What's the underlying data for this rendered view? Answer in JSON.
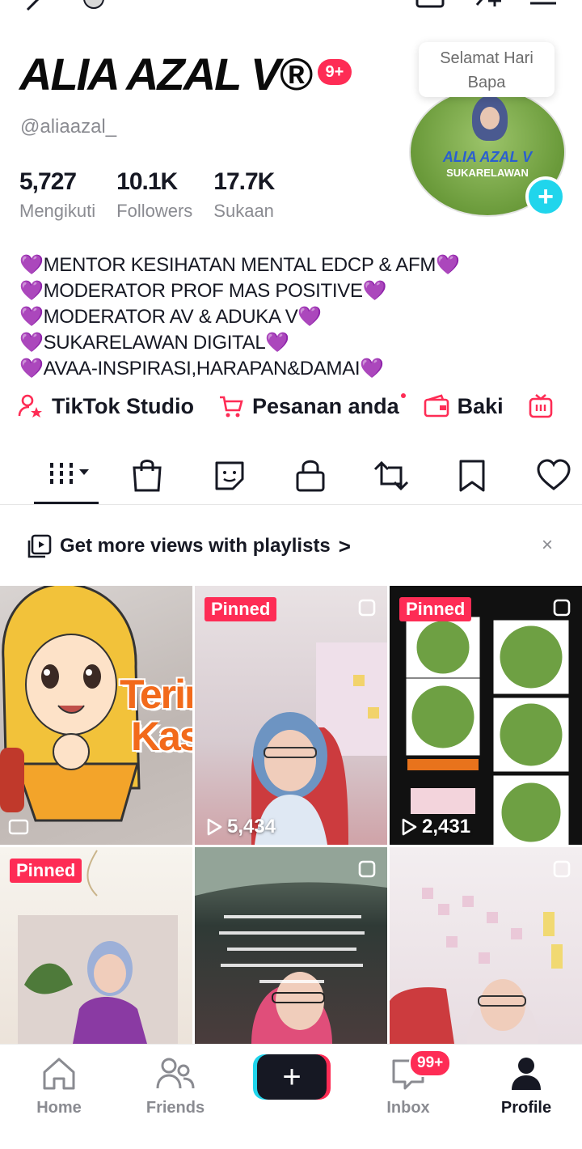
{
  "profile": {
    "name": "ALIA AZAL V®",
    "notification_badge": "9+",
    "handle": "@aliaazal_",
    "bubble_text_1": "Selamat Hari",
    "bubble_text_2": "Bapa",
    "avatar_text_1": "ALIA AZAL V",
    "avatar_text_2": "SUKARELAWAN",
    "stats": [
      {
        "value": "5,727",
        "label": "Mengikuti"
      },
      {
        "value": "10.1K",
        "label": "Followers"
      },
      {
        "value": "17.7K",
        "label": "Sukaan"
      }
    ],
    "bio": [
      "MENTOR KESIHATAN MENTAL EDCP & AFM",
      "MODERATOR PROF MAS POSITIVE",
      "MODERATOR AV & ADUKA V",
      "SUKARELAWAN DIGITAL",
      "AVAA-INSPIRASI,HARAPAN&DAMAI"
    ],
    "bio_heart": "💜"
  },
  "links": {
    "studio": "TikTok Studio",
    "orders": "Pesanan anda",
    "tray": "Baki"
  },
  "playlist_banner": {
    "text": "Get more views with playlists",
    "chevron": ">",
    "close": "×"
  },
  "grid": {
    "pinned_label": "Pinned",
    "cell1_text_1": "Terima",
    "cell1_text_2": "Kasih",
    "cell2_views": "5,434",
    "cell3_views": "2,431"
  },
  "navbar": {
    "home": "Home",
    "friends": "Friends",
    "inbox": "Inbox",
    "inbox_badge": "99+",
    "profile": "Profile",
    "create": "+"
  },
  "colors": {
    "accent_red": "#fe2c55",
    "accent_cyan": "#20d5ec",
    "heart_purple": "#8b3fcf"
  }
}
